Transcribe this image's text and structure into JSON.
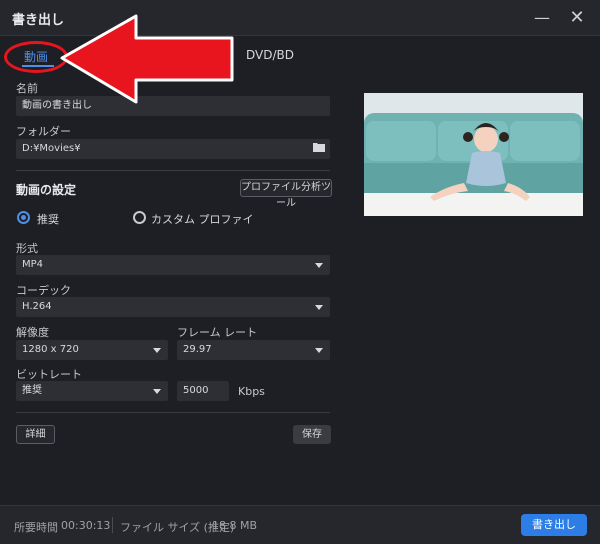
{
  "window": {
    "title": "書き出し"
  },
  "tabs": [
    {
      "label": "動画"
    },
    {
      "label": "DVD/BD"
    }
  ],
  "name": {
    "label": "名前",
    "value": "動画の書き出し"
  },
  "folder": {
    "label": "フォルダー",
    "value": "D:¥Movies¥"
  },
  "video_settings": {
    "title": "動画の設定",
    "profile_button": "プロファイル分析ツール",
    "radio_recommended": "推奨",
    "radio_custom": "カスタム プロファイ"
  },
  "format": {
    "label": "形式",
    "value": "MP4"
  },
  "codec": {
    "label": "コーデック",
    "value": "H.264"
  },
  "resolution": {
    "label": "解像度",
    "value": "1280 x 720"
  },
  "framerate": {
    "label": "フレーム レート",
    "value": "29.97"
  },
  "bitrate": {
    "label": "ビットレート",
    "mode": "推奨",
    "value": "5000",
    "unit": "Kbps"
  },
  "buttons": {
    "detail": "詳細",
    "save": "保存",
    "export": "書き出し"
  },
  "footer": {
    "time_label": "所要時間",
    "time_value": "00:30:13",
    "size_label": "ファイル サイズ (推定)",
    "size_value": "18.8 MB"
  },
  "colors": {
    "accent": "#2d7de6",
    "annotation": "#e8141e",
    "background": "#1e1f24"
  }
}
